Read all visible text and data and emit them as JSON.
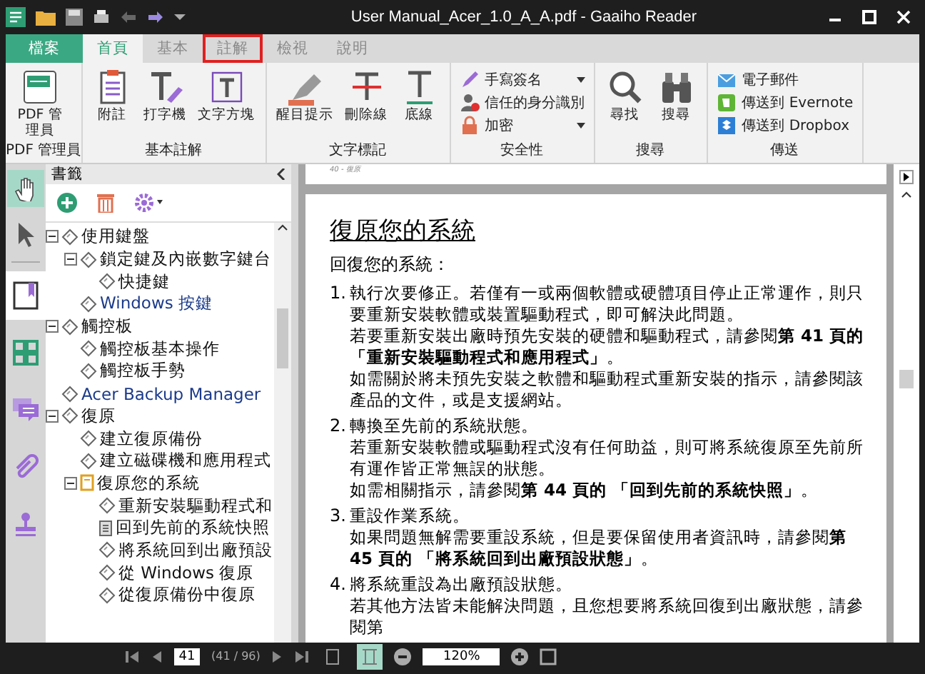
{
  "window": {
    "title": "User Manual_Acer_1.0_A_A.pdf - Gaaiho Reader"
  },
  "ribbon_tabs": [
    {
      "label": "檔案",
      "kind": "file",
      "selected": false,
      "highlighted": false
    },
    {
      "label": "首頁",
      "kind": "tab",
      "selected": true,
      "highlighted": false
    },
    {
      "label": "基本",
      "kind": "tab",
      "selected": false,
      "highlighted": false
    },
    {
      "label": "註解",
      "kind": "tab",
      "selected": false,
      "highlighted": true
    },
    {
      "label": "檢視",
      "kind": "tab",
      "selected": false,
      "highlighted": false
    },
    {
      "label": "說明",
      "kind": "tab",
      "selected": false,
      "highlighted": false
    }
  ],
  "ribbon_groups": [
    {
      "label": "PDF 管理員",
      "items": [
        {
          "label": "PDF 管理員",
          "kind": "large"
        }
      ]
    },
    {
      "label": "基本註解",
      "items": [
        {
          "label": "附註",
          "kind": "large"
        },
        {
          "label": "打字機",
          "kind": "large"
        },
        {
          "label": "文字方塊",
          "kind": "large"
        }
      ]
    },
    {
      "label": "文字標記",
      "items": [
        {
          "label": "醒目提示",
          "kind": "large"
        },
        {
          "label": "刪除線",
          "kind": "large"
        },
        {
          "label": "底線",
          "kind": "large"
        }
      ]
    },
    {
      "label": "安全性",
      "items": [
        {
          "label": "手寫簽名",
          "kind": "small",
          "dropdown": true
        },
        {
          "label": "信任的身分識別",
          "kind": "small",
          "dropdown": false
        },
        {
          "label": "加密",
          "kind": "small",
          "dropdown": true
        }
      ]
    },
    {
      "label": "搜尋",
      "items": [
        {
          "label": "尋找",
          "kind": "large"
        },
        {
          "label": "搜尋",
          "kind": "large"
        }
      ]
    },
    {
      "label": "傳送",
      "items": [
        {
          "label": "電子郵件",
          "kind": "small",
          "dropdown": false
        },
        {
          "label": "傳送到 Evernote",
          "kind": "small",
          "dropdown": false
        },
        {
          "label": "傳送到 Dropbox",
          "kind": "small",
          "dropdown": false
        }
      ]
    }
  ],
  "tools": [
    {
      "selected": true
    },
    {
      "selected": false
    }
  ],
  "panels": [
    {
      "selected": true
    },
    {
      "selected": false
    },
    {
      "selected": false
    },
    {
      "selected": false
    },
    {
      "selected": false
    }
  ],
  "bookmarks": {
    "title": "書籤",
    "tree": [
      {
        "label": "使用鍵盤",
        "kind": "bookmark",
        "expanded": true,
        "children": [
          {
            "label": "鎖定鍵及內嵌數字鍵台",
            "kind": "bookmark",
            "expanded": true,
            "children": [
              {
                "label": "快捷鍵",
                "kind": "bookmark"
              }
            ]
          },
          {
            "label": "Windows 按鍵",
            "kind": "bookmark"
          }
        ]
      },
      {
        "label": "觸控板",
        "kind": "bookmark",
        "expanded": true,
        "children": [
          {
            "label": "觸控板基本操作",
            "kind": "bookmark"
          },
          {
            "label": "觸控板手勢",
            "kind": "bookmark"
          }
        ]
      },
      {
        "label": "Acer Backup Manager",
        "kind": "bookmark"
      },
      {
        "label": "復原",
        "kind": "bookmark",
        "expanded": true,
        "children": [
          {
            "label": "建立復原備份",
            "kind": "bookmark"
          },
          {
            "label": "建立磁碟機和應用程式",
            "kind": "bookmark"
          },
          {
            "label": "復原您的系統",
            "kind": "current",
            "expanded": true,
            "children": [
              {
                "label": "重新安裝驅動程式和",
                "kind": "bookmark"
              },
              {
                "label": "回到先前的系統快照",
                "kind": "page"
              },
              {
                "label": "將系統回到出廠預設",
                "kind": "bookmark"
              },
              {
                "label": "從 Windows 復原",
                "kind": "bookmark"
              },
              {
                "label": "從復原備份中復原",
                "kind": "bookmark"
              }
            ]
          }
        ]
      }
    ]
  },
  "document": {
    "page_footer": "40 - 復原",
    "heading": "復原您的系統",
    "intro": "回復您的系統：",
    "steps": [
      {
        "number": "1.",
        "paragraphs": [
          "執行次要修正。若僅有一或兩個軟體或硬體項目停止正常運作，則只要重新安裝軟體或裝置驅動程式，即可解決此問題。",
          "若要重新安裝出廠時預先安裝的硬體和驅動程式，請參閱**第 41 頁的「重新安裝驅動程式和應用程式」**。",
          "如需關於將未預先安裝之軟體和驅動程式重新安裝的指示，請參閱該產品的文件，或是支援網站。"
        ]
      },
      {
        "number": "2.",
        "paragraphs": [
          "轉換至先前的系統狀態。",
          "若重新安裝軟體或驅動程式沒有任何助益，則可將系統復原至先前所有運作皆正常無誤的狀態。",
          "如需相關指示，請參閱**第 44 頁的 「回到先前的系統快照」**。"
        ]
      },
      {
        "number": "3.",
        "paragraphs": [
          "重設作業系統。",
          "如果問題無解需要重設系統，但是要保留使用者資訊時，請參閱**第 45 頁的 「將系統回到出廠預設狀態」**。"
        ]
      },
      {
        "number": "4.",
        "paragraphs": [
          "將系統重設為出廠預設狀態。",
          "若其他方法皆未能解決問題，且您想要將系統回復到出廠狀態，請參閱第"
        ]
      }
    ]
  },
  "status_bar": {
    "page": "41",
    "page_count": "(41 / 96)",
    "zoom": "120%",
    "view_buttons": [
      {
        "selected": false
      },
      {
        "selected": true
      }
    ]
  }
}
